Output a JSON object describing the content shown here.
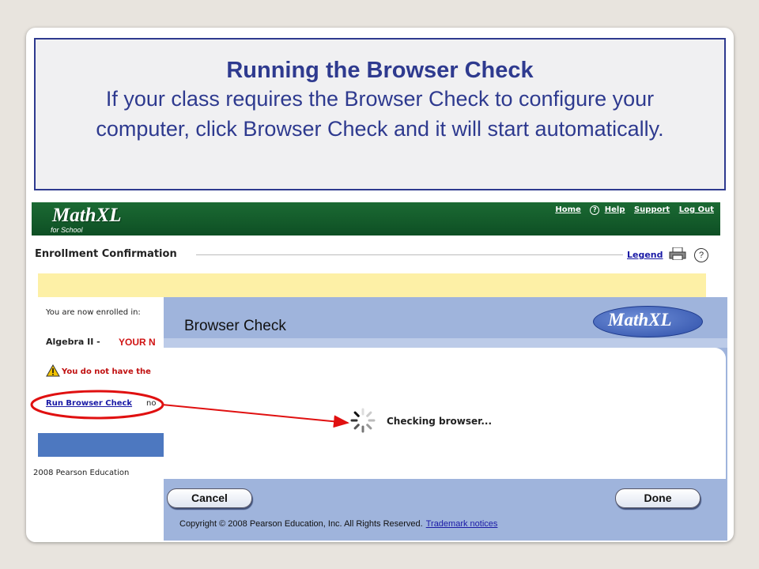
{
  "callout": {
    "title": "Running the Browser Check",
    "body": "If your class requires the Browser Check to configure your computer, click Browser Check and it will start automatically."
  },
  "header": {
    "logo": "Math",
    "logo_suffix": "XL",
    "logo_sub": "for School",
    "links": {
      "home": "Home",
      "help_icon": "?",
      "help": "Help",
      "support": "Support",
      "logout": "Log Out"
    }
  },
  "page": {
    "title": "Enrollment Confirmation",
    "legend": "Legend",
    "help_icon": "?",
    "enrolled_text": "You are now enrolled in:",
    "course": "Algebra II -",
    "course_owner": "YOUR N",
    "warning": "You do not have the",
    "run_link": "Run Browser Check",
    "run_rest": "no",
    "copyright": "2008 Pearson Education"
  },
  "dialog": {
    "title": "Browser Check",
    "logo": "Math",
    "logo_suffix": "XL",
    "status": "Checking browser...",
    "cancel": "Cancel",
    "done": "Done",
    "copyright": "Copyright © 2008 Pearson Education, Inc. All Rights Reserved.",
    "trademark": "Trademark notices"
  },
  "colors": {
    "callout_text": "#2e3a8f",
    "header_green": "#1b6a33",
    "dialog_blue": "#9fb4dc",
    "highlight_red": "#e01010"
  },
  "icons": [
    "help-icon",
    "printer-icon",
    "warning-icon",
    "spinner-icon"
  ]
}
